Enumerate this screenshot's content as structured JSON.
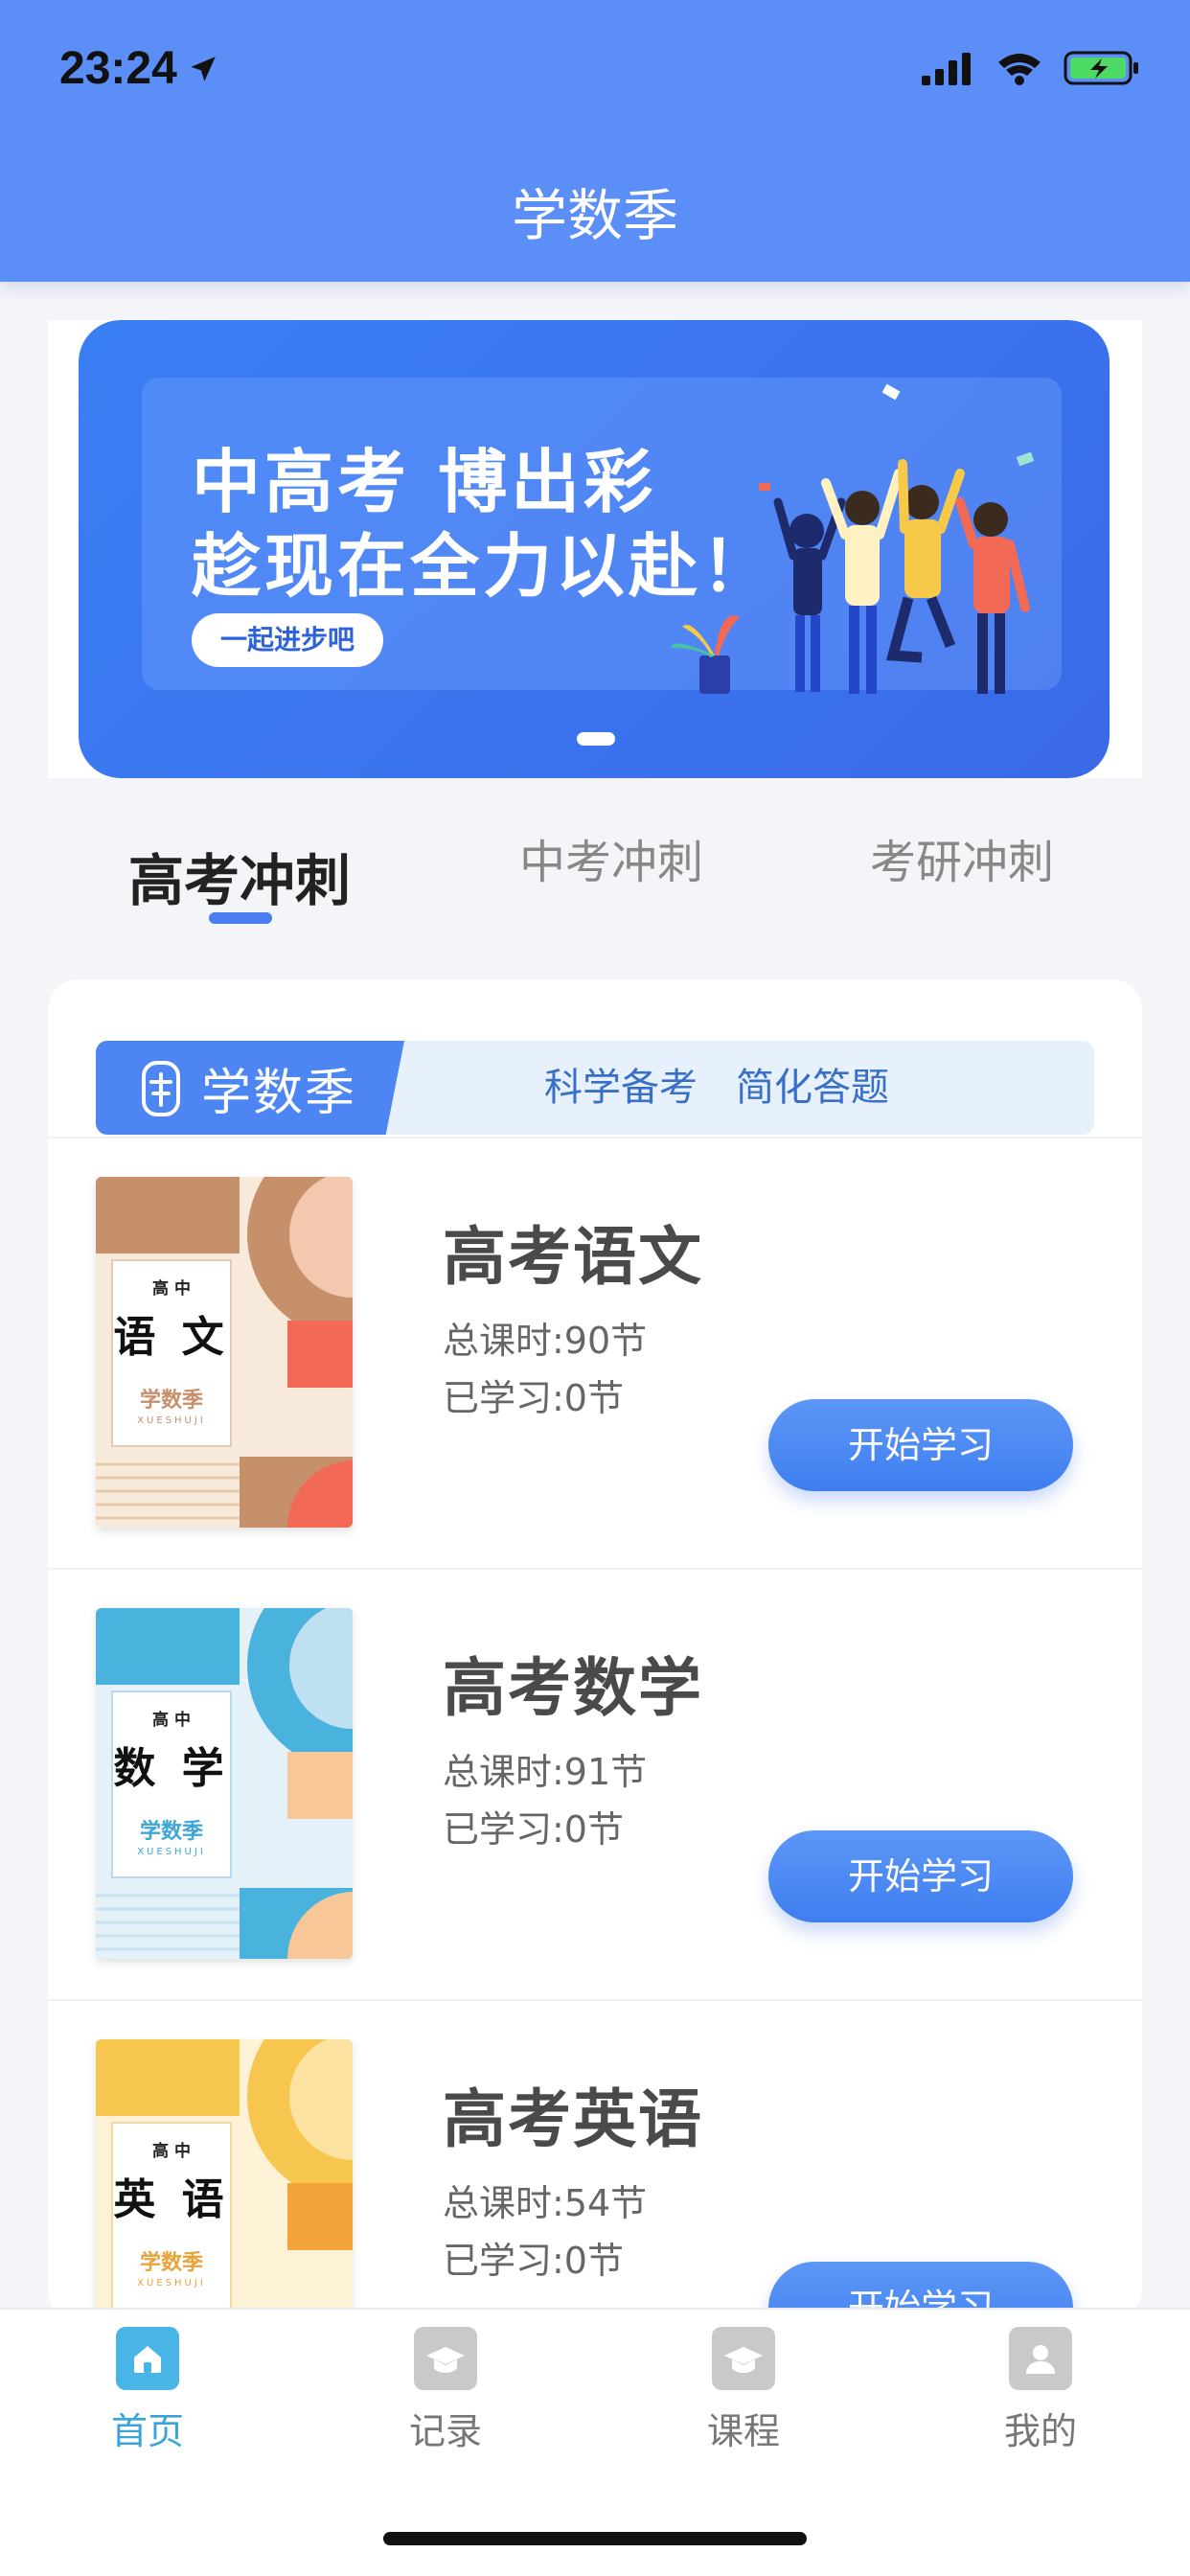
{
  "status_bar": {
    "time": "23:24"
  },
  "header": {
    "title": "学数季"
  },
  "banner": {
    "line1": "中高考 博出彩",
    "line2": "趁现在全力以赴！",
    "pill_label": "一起进步吧"
  },
  "tabs": [
    {
      "label": "高考冲刺",
      "active": true
    },
    {
      "label": "中考冲刺",
      "active": false
    },
    {
      "label": "考研冲刺",
      "active": false
    }
  ],
  "brand_bar": {
    "name": "学数季",
    "slogan1": "科学备考",
    "slogan2": "简化答题"
  },
  "courses": [
    {
      "title": "高考语文",
      "total": "总课时:90节",
      "studied": "已学习:0节",
      "button": "开始学习",
      "cover": {
        "top": "高 中",
        "main": "语 文",
        "brand": "学数季",
        "sub": "XUESHUJI",
        "accent": "#f26a55"
      }
    },
    {
      "title": "高考数学",
      "total": "总课时:91节",
      "studied": "已学习:0节",
      "button": "开始学习",
      "cover": {
        "top": "高 中",
        "main": "数 学",
        "brand": "学数季",
        "sub": "XUESHUJI",
        "accent": "#4ab3dd"
      }
    },
    {
      "title": "高考英语",
      "total": "总课时:54节",
      "studied": "已学习:0节",
      "button": "开始学习",
      "cover": {
        "top": "高 中",
        "main": "英 语",
        "brand": "学数季",
        "sub": "XUESHUJI",
        "accent": "#f2a33a"
      }
    }
  ],
  "bottom_nav": [
    {
      "label": "首页",
      "icon": "home-icon",
      "active": true
    },
    {
      "label": "记录",
      "icon": "graduation-cap-icon",
      "active": false
    },
    {
      "label": "课程",
      "icon": "graduation-cap-icon",
      "active": false
    },
    {
      "label": "我的",
      "icon": "user-icon",
      "active": false
    }
  ],
  "colors": {
    "header_bg": "#5b8ef6",
    "accent": "#4a7df0",
    "nav_active": "#3aa3da"
  }
}
